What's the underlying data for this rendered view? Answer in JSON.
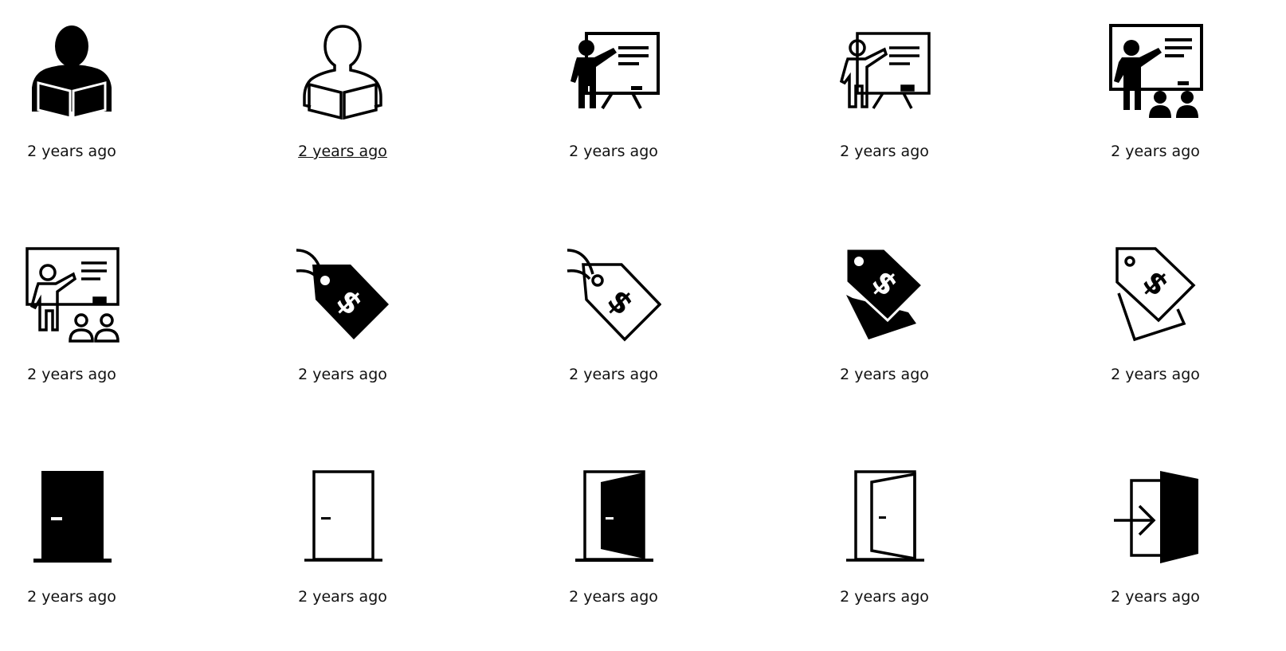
{
  "colors": {
    "icon": "#000000",
    "text": "#111111",
    "background": "#ffffff"
  },
  "items": [
    {
      "icon": "person-reading-solid-icon",
      "time_label": "2 years ago",
      "hovered": false
    },
    {
      "icon": "person-reading-outline-icon",
      "time_label": "2 years ago",
      "hovered": true
    },
    {
      "icon": "teacher-whiteboard-solid-icon",
      "time_label": "2 years ago",
      "hovered": false
    },
    {
      "icon": "teacher-whiteboard-outline-icon",
      "time_label": "2 years ago",
      "hovered": false
    },
    {
      "icon": "classroom-solid-icon",
      "time_label": "2 years ago",
      "hovered": false
    },
    {
      "icon": "classroom-outline-icon",
      "time_label": "2 years ago",
      "hovered": false
    },
    {
      "icon": "price-tag-solid-icon",
      "time_label": "2 years ago",
      "hovered": false
    },
    {
      "icon": "price-tag-outline-icon",
      "time_label": "2 years ago",
      "hovered": false
    },
    {
      "icon": "price-tags-solid-icon",
      "time_label": "2 years ago",
      "hovered": false
    },
    {
      "icon": "price-tags-outline-icon",
      "time_label": "2 years ago",
      "hovered": false
    },
    {
      "icon": "door-closed-solid-icon",
      "time_label": "2 years ago",
      "hovered": false
    },
    {
      "icon": "door-closed-outline-icon",
      "time_label": "2 years ago",
      "hovered": false
    },
    {
      "icon": "door-open-solid-icon",
      "time_label": "2 years ago",
      "hovered": false
    },
    {
      "icon": "door-open-outline-icon",
      "time_label": "2 years ago",
      "hovered": false
    },
    {
      "icon": "sign-in-door-icon",
      "time_label": "2 years ago",
      "hovered": false
    }
  ]
}
